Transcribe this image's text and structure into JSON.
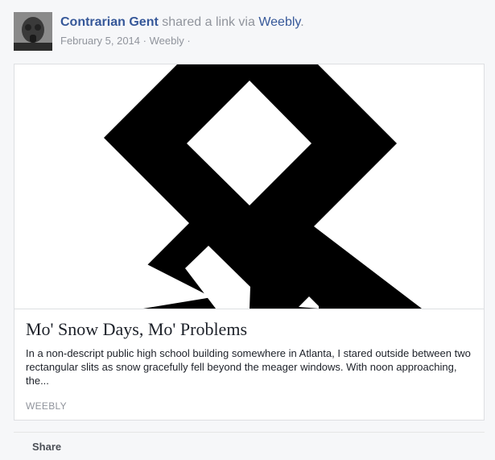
{
  "post": {
    "author": "Contrarian Gent",
    "action_text": "shared a link via",
    "via": "Weebly",
    "period": ".",
    "date": "February 5, 2014",
    "separator": "·",
    "source_app": "Weebly",
    "trailing_dot": "·"
  },
  "link_card": {
    "image_icon": "black-cross-symbol",
    "title": "Mo' Snow Days, Mo' Problems",
    "description": "In a non-descript public high school building somewhere in Atlanta, I stared outside between two rectangular slits as snow gracefully fell beyond the meager windows. With noon approaching, the...",
    "source": "WEEBLY"
  },
  "actions": {
    "share_label": "Share"
  },
  "colors": {
    "link_blue": "#365899",
    "meta_gray": "#90949c",
    "background": "#f6f7f9"
  }
}
